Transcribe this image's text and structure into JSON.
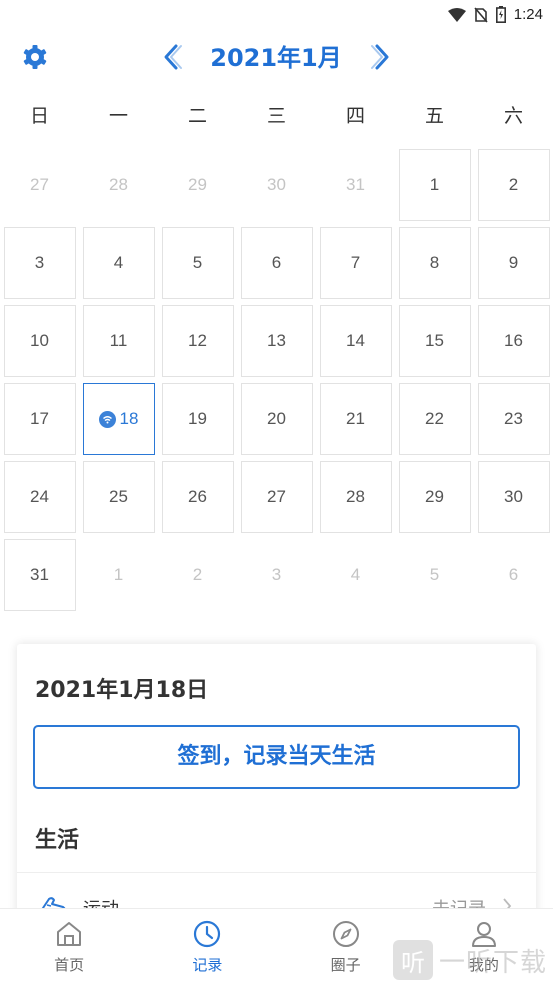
{
  "status_bar": {
    "time": "1:24"
  },
  "header": {
    "month_title": "2021年1月"
  },
  "weekdays": [
    "日",
    "一",
    "二",
    "三",
    "四",
    "五",
    "六"
  ],
  "calendar": {
    "rows": [
      [
        "27",
        "28",
        "29",
        "30",
        "31",
        "1",
        "2"
      ],
      [
        "3",
        "4",
        "5",
        "6",
        "7",
        "8",
        "9"
      ],
      [
        "10",
        "11",
        "12",
        "13",
        "14",
        "15",
        "16"
      ],
      [
        "17",
        "18",
        "19",
        "20",
        "21",
        "22",
        "23"
      ],
      [
        "24",
        "25",
        "26",
        "27",
        "28",
        "29",
        "30"
      ],
      [
        "31",
        "1",
        "2",
        "3",
        "4",
        "5",
        "6"
      ]
    ],
    "selected_day": "18"
  },
  "card": {
    "date": "2021年1月18日",
    "checkin_button": "签到，记录当天生活",
    "section_title": "生活",
    "row": {
      "label": "运动",
      "status": "未记录"
    }
  },
  "nav": {
    "items": [
      {
        "label": "首页"
      },
      {
        "label": "记录"
      },
      {
        "label": "圈子"
      },
      {
        "label": "我的"
      }
    ],
    "active_index": 1
  },
  "watermark": {
    "box_char": "听",
    "text": "一听下载"
  },
  "colors": {
    "accent": "#1f6fd4",
    "muted_day": "#c4c4c4",
    "border": "#e2e2e2"
  }
}
